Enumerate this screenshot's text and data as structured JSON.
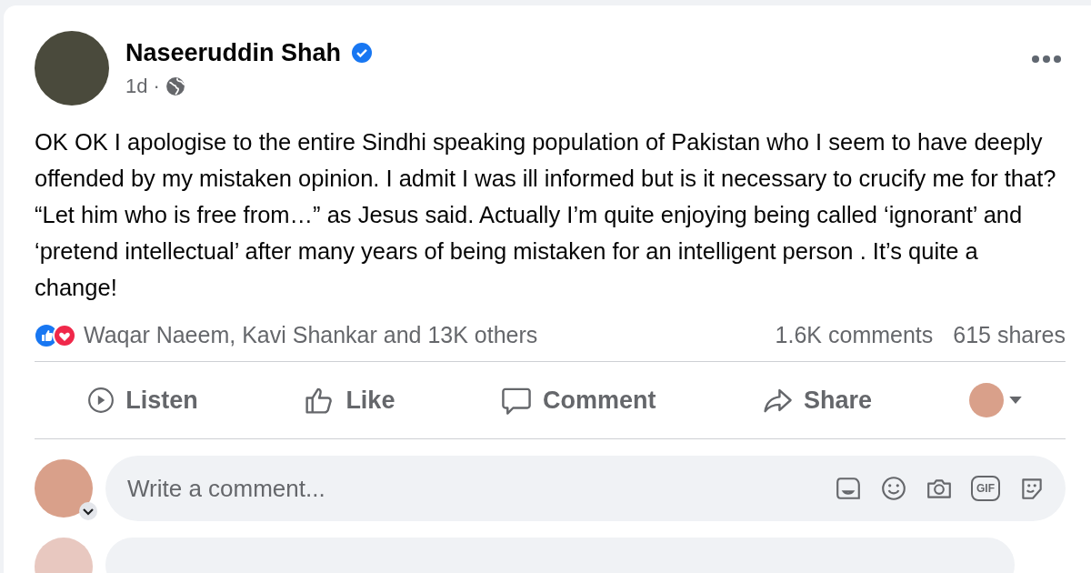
{
  "post": {
    "author": "Naseeruddin Shah",
    "verified": true,
    "time": "1d",
    "separator": "·",
    "text": "OK OK I apologise to the entire Sindhi speaking population of Pakistan who I seem to have deeply offended by my mistaken opinion. I admit I was ill informed  but is it necessary to crucify me for that? “Let him who is free from…” as Jesus said. Actually I’m quite enjoying being called ‘ignorant’ and ‘pretend intellectual’ after many years of being mistaken for an intelligent person . It’s quite a change!",
    "reactions": "Waqar Naeem, Kavi Shankar and 13K others",
    "comments": "1.6K comments",
    "shares": "615 shares"
  },
  "actions": [
    {
      "kind": "listen",
      "label": "Listen"
    },
    {
      "kind": "like",
      "label": "Like"
    },
    {
      "kind": "comment",
      "label": "Comment"
    },
    {
      "kind": "share",
      "label": "Share"
    }
  ],
  "comment_box": {
    "placeholder": "Write a comment...",
    "gif_label": "GIF"
  }
}
